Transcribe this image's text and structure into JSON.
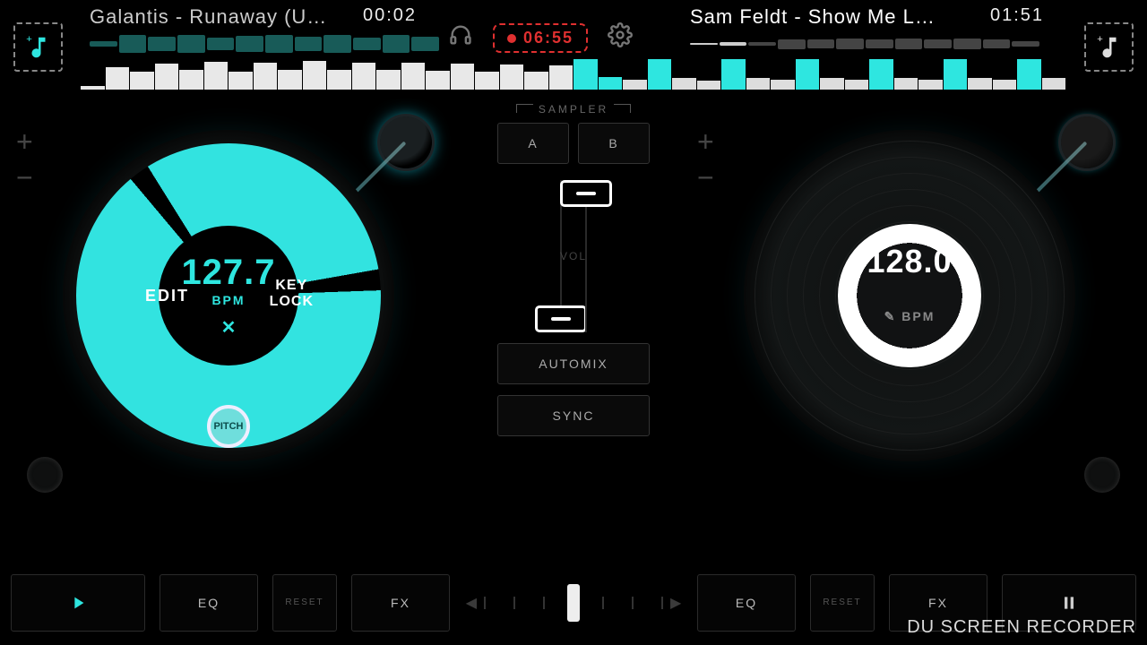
{
  "colors": {
    "accent": "#2ee6e0",
    "record": "#e03030"
  },
  "header": {
    "left_track": {
      "title": "Galantis - Runaway (U…",
      "time": "00:02"
    },
    "right_track": {
      "title": "Sam Feldt - Show Me L…",
      "time": "01:51"
    },
    "record_time": "06:55"
  },
  "deck_left": {
    "bpm_value": "127.7",
    "bpm_label": "BPM",
    "edit_label": "EDIT",
    "keylock_label": "KEY\nLOCK",
    "pitch_label": "PITCH"
  },
  "deck_right": {
    "bpm_value": "128.0",
    "bpm_label": "BPM"
  },
  "center": {
    "sampler_label": "SAMPLER",
    "a_label": "A",
    "b_label": "B",
    "vol_label": "VOL",
    "automix_label": "AUTOMIX",
    "sync_label": "SYNC"
  },
  "bottom": {
    "eq_label": "EQ",
    "reset_label": "RESET",
    "fx_label": "FX"
  },
  "watermark": "DU SCREEN RECORDER"
}
